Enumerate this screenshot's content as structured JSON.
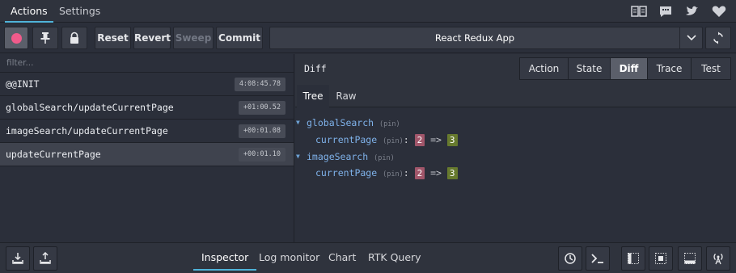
{
  "nav": {
    "tabs": [
      {
        "label": "Actions",
        "active": true
      },
      {
        "label": "Settings",
        "active": false
      }
    ],
    "icons": [
      "book-icon",
      "chat-icon",
      "twitter-icon",
      "heart-icon"
    ]
  },
  "toolbar": {
    "record_icon": "record-dot-icon",
    "pin_icon": "pin-icon",
    "lock_icon": "lock-icon",
    "reset_label": "Reset",
    "revert_label": "Revert",
    "sweep_label": "Sweep",
    "commit_label": "Commit",
    "instance_label": "React Redux App",
    "sync_icon": "sync-icon"
  },
  "actions": {
    "filter_placeholder": "filter...",
    "items": [
      {
        "name": "@@INIT",
        "time": "4:08:45.78",
        "selected": false
      },
      {
        "name": "globalSearch/updateCurrentPage",
        "time": "+01:00.52",
        "selected": false
      },
      {
        "name": "imageSearch/updateCurrentPage",
        "time": "+00:01.08",
        "selected": false
      },
      {
        "name": "updateCurrentPage",
        "time": "+00:01.10",
        "selected": true
      }
    ]
  },
  "inspector": {
    "title": "Diff",
    "tabs": [
      {
        "label": "Action",
        "active": false
      },
      {
        "label": "State",
        "active": false
      },
      {
        "label": "Diff",
        "active": true
      },
      {
        "label": "Trace",
        "active": false
      },
      {
        "label": "Test",
        "active": false
      }
    ],
    "subtabs": [
      {
        "label": "Tree",
        "active": true
      },
      {
        "label": "Raw",
        "active": false
      }
    ],
    "tree": [
      {
        "key": "globalSearch",
        "pin": "(pin)",
        "children": [
          {
            "key": "currentPage",
            "pin": "(pin)",
            "old": "2",
            "arrow": "=>",
            "new": "3"
          }
        ]
      },
      {
        "key": "imageSearch",
        "pin": "(pin)",
        "children": [
          {
            "key": "currentPage",
            "pin": "(pin)",
            "old": "2",
            "arrow": "=>",
            "new": "3"
          }
        ]
      }
    ]
  },
  "bottom": {
    "monitors": [
      {
        "label": "Inspector",
        "active": true
      },
      {
        "label": "Log monitor",
        "active": false
      },
      {
        "label": "Chart",
        "active": false
      },
      {
        "label": "RTK Query",
        "active": false
      }
    ],
    "left_icons": [
      "import-icon",
      "export-icon"
    ],
    "right_icons": [
      "dispatcher-timer-icon",
      "terminal-icon",
      "dock-left-icon",
      "dock-center-icon",
      "dock-bottom-icon",
      "remote-broadcast-icon"
    ]
  },
  "colors": {
    "accent": "#4fb3d9",
    "record": "#f05b8b",
    "diff_removed": "#a1566a",
    "diff_added": "#677a2e",
    "tree_key": "#7fb2ea"
  }
}
